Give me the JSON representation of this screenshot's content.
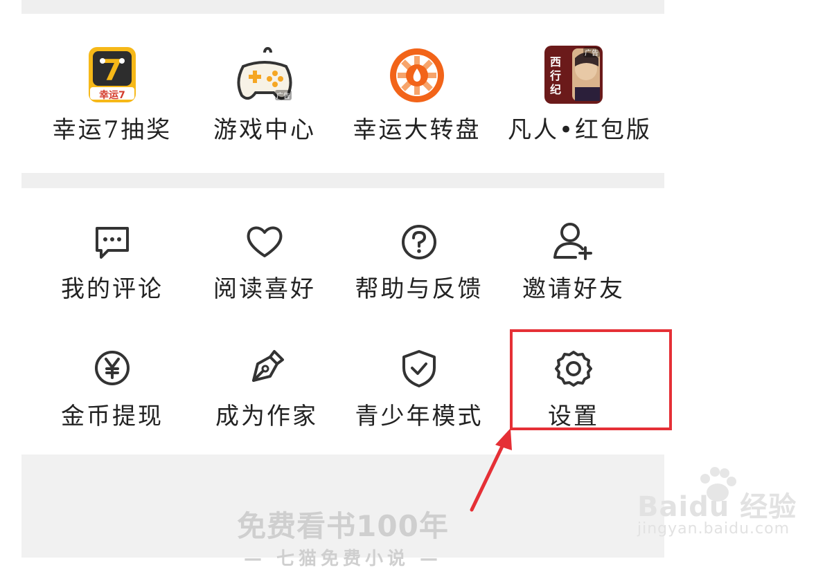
{
  "top_row": [
    {
      "label": "幸运7抽奖",
      "icon": "lucky-seven-icon",
      "badge": "幸运7"
    },
    {
      "label": "游戏中心",
      "icon": "gamepad-icon",
      "ad": "广告"
    },
    {
      "label": "幸运大转盘",
      "icon": "lucky-wheel-icon"
    },
    {
      "label": "凡人•红包版",
      "icon": "game-app-icon",
      "ad": "广告",
      "art_text": "西行纪"
    }
  ],
  "tools_row1": [
    {
      "label": "我的评论",
      "icon": "comment-icon"
    },
    {
      "label": "阅读喜好",
      "icon": "heart-icon"
    },
    {
      "label": "帮助与反馈",
      "icon": "help-icon"
    },
    {
      "label": "邀请好友",
      "icon": "add-user-icon"
    }
  ],
  "tools_row2": [
    {
      "label": "金币提现",
      "icon": "yuan-coin-icon"
    },
    {
      "label": "成为作家",
      "icon": "pen-icon"
    },
    {
      "label": "青少年模式",
      "icon": "shield-check-icon"
    },
    {
      "label": "设置",
      "icon": "gear-icon"
    }
  ],
  "footer": {
    "slogan": "免费看书100年",
    "sub": "— 七猫免费小说 —"
  },
  "watermark": {
    "main": "Baidu 经验",
    "sub": "jingyan.baidu.com"
  },
  "colors": {
    "highlight": "#e53036",
    "wheel_orange": "#f26419",
    "icon_stroke": "#333333",
    "separator": "#efefef"
  }
}
